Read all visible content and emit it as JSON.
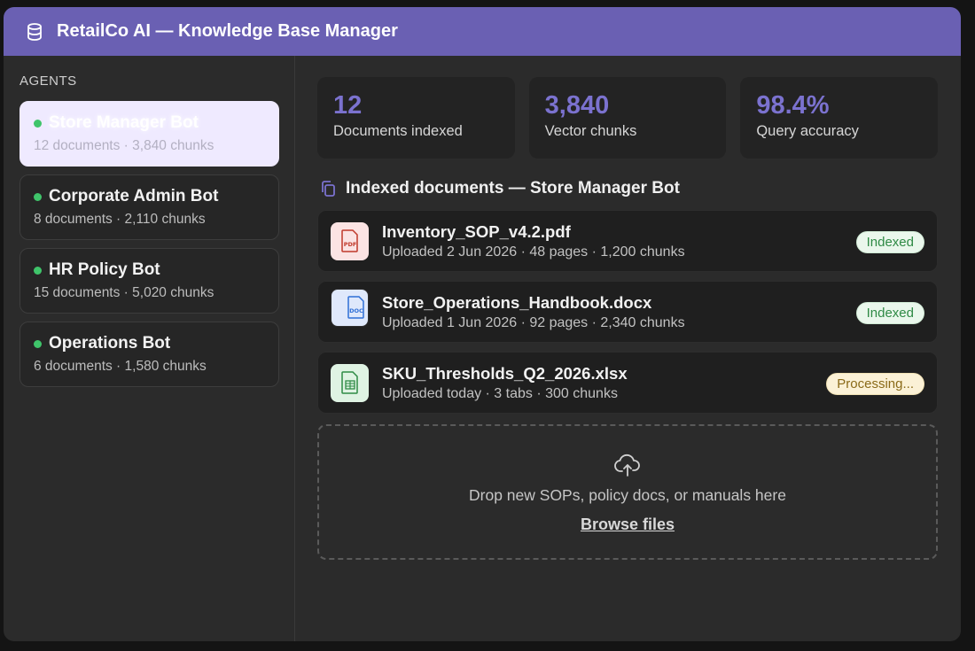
{
  "app": {
    "title": "RetailCo AI — Knowledge Base Manager",
    "accent_color": "#6a60b3",
    "title_icon": "database-icon"
  },
  "sidebar": {
    "heading": "AGENTS",
    "agents": [
      {
        "name": "Store Manager Bot",
        "meta": "12 documents · 3,840 chunks",
        "status": "online",
        "active": true
      },
      {
        "name": "Corporate Admin Bot",
        "meta": "8 documents · 2,110 chunks",
        "status": "online",
        "active": false
      },
      {
        "name": "HR Policy Bot",
        "meta": "15 documents · 5,020 chunks",
        "status": "online",
        "active": false
      },
      {
        "name": "Operations Bot",
        "meta": "6 documents · 1,580 chunks",
        "status": "online",
        "active": false
      }
    ]
  },
  "stats": [
    {
      "value": "12",
      "label": "Documents indexed"
    },
    {
      "value": "3,840",
      "label": "Vector chunks"
    },
    {
      "value": "98.4%",
      "label": "Query accuracy"
    }
  ],
  "documents_section": {
    "heading": "Indexed documents — Store Manager Bot",
    "icon": "copy-icon",
    "documents": [
      {
        "name": "Inventory_SOP_v4.2.pdf",
        "meta": "Uploaded 2 Jun 2026 · 48 pages · 1,200 chunks",
        "type": "PDF",
        "status": "Indexed"
      },
      {
        "name": "Store_Operations_Handbook.docx",
        "meta": "Uploaded 1 Jun 2026 · 92 pages · 2,340 chunks",
        "type": "DOC",
        "status": "Indexed"
      },
      {
        "name": "SKU_Thresholds_Q2_2026.xlsx",
        "meta": "Uploaded today · 3 tabs · 300 chunks",
        "type": "XLS",
        "status": "Processing..."
      }
    ]
  },
  "dropzone": {
    "icon": "cloud-upload-icon",
    "hint": "Drop new SOPs, policy docs, or manuals here",
    "browse_label": "Browse files"
  }
}
